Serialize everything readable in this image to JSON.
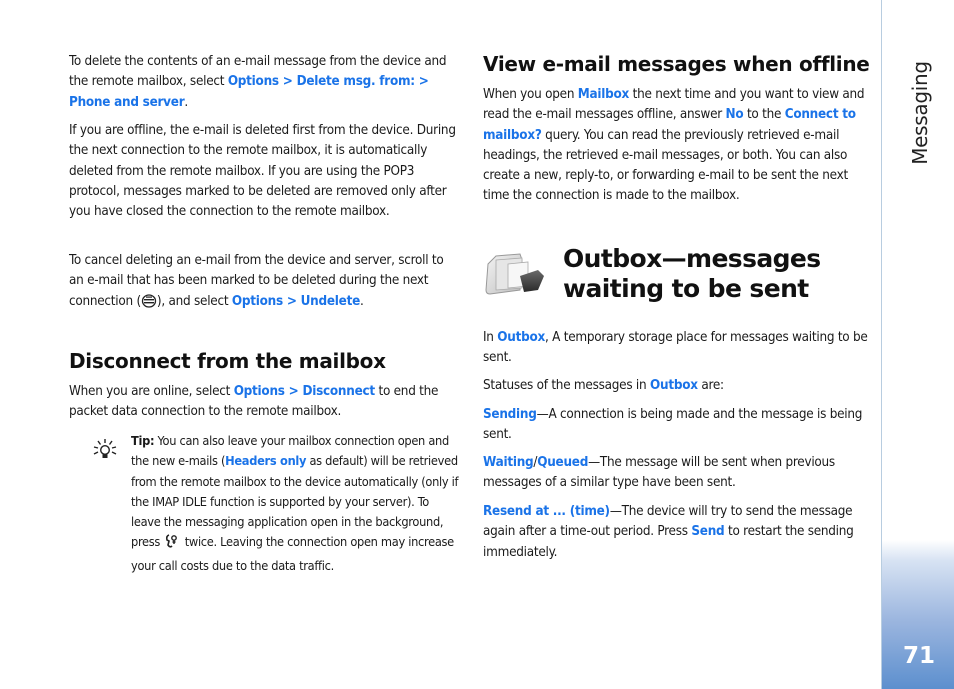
{
  "sidebar": {
    "section_title": "Messaging",
    "page_number": "71",
    "accent_color": "#5c8fce"
  },
  "left_column": {
    "para1": {
      "before": "To delete the contents of an e-mail message from the device and the remote mailbox, select ",
      "link": "Options > Delete msg. from: > Phone and server",
      "after": "."
    },
    "para2": "If you are offline, the e-mail is deleted first from the device. During the next connection to the remote mailbox, it is automatically deleted from the remote mailbox. If you are using the POP3 protocol, messages marked to be deleted are removed only after you have closed the connection to the remote mailbox.",
    "para3": {
      "before": "To cancel deleting an e-mail from the device and server, scroll to an e-mail that has been marked to be deleted during the next connection (",
      "icon": "marked-for-deletion-icon",
      "middle": "), and select ",
      "link": "Options > Undelete",
      "after": "."
    },
    "heading_disconnect": "Disconnect from the mailbox",
    "para4": {
      "before": "When you are online, select ",
      "link": "Options > Disconnect",
      "after": " to end the packet data connection to the remote mailbox."
    },
    "tip": {
      "icon": "lightbulb-tip-icon",
      "label": "Tip:",
      "text1": " You can also leave your mailbox connection open and the new e-mails (",
      "link": "Headers only",
      "text2": " as default) will be retrieved from the remote mailbox to the device automatically (only if the IMAP IDLE function is supported by your server). To leave the messaging application open in the background, press ",
      "key_icon": "menu-key-icon",
      "text3": " twice. Leaving the connection open may increase your call costs due to the data traffic."
    }
  },
  "right_column": {
    "heading_offline": "View e-mail messages when offline",
    "para_offline": {
      "t1": "When you open ",
      "l1": "Mailbox",
      "t2": " the next time and you want to view and read the e-mail messages offline, answer ",
      "l2": "No",
      "t3": " to the ",
      "l3": "Connect to mailbox?",
      "t4": " query. You can read the previously retrieved e-mail headings, the retrieved e-mail messages, or both. You can also create a new, reply-to, or forwarding e-mail to be sent the next time the connection is made to the mailbox."
    },
    "heading_outbox": "Outbox—messages waiting to be sent",
    "outbox_icon": "outbox-folder-icon",
    "para_outbox": {
      "t1": "In ",
      "l1": "Outbox",
      "t2": ", A temporary storage place for messages waiting to be sent."
    },
    "para_statuses": {
      "t1": "Statuses of the messages in ",
      "l1": "Outbox",
      "t2": " are:"
    },
    "status_sending": {
      "link": "Sending",
      "text": "—A connection is being made and the message is being sent."
    },
    "status_waiting": {
      "link1": "Waiting",
      "sep": "/",
      "link2": "Queued",
      "text": "—The message will be sent when previous messages of a similar type have been sent."
    },
    "status_resend": {
      "link": "Resend at ... (time)",
      "text1": "—The device will try to send the message again after a time-out period. Press ",
      "link2": "Send",
      "text2": " to restart the sending immediately."
    }
  }
}
